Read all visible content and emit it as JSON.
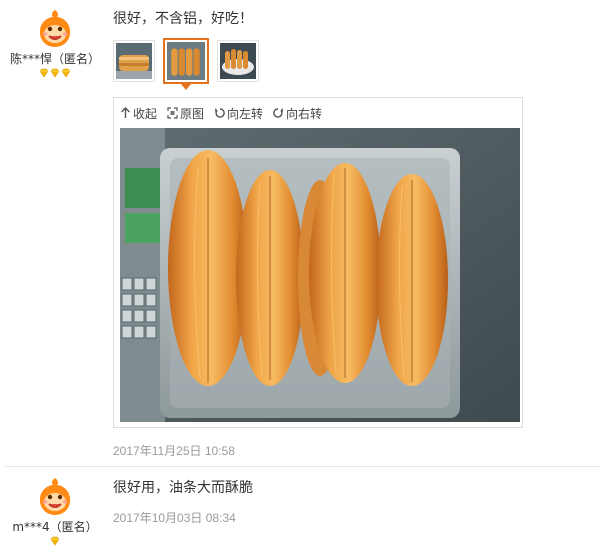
{
  "reviews": [
    {
      "user": {
        "nickname": "陈***悍（匿名）",
        "avatar_icon": "orange-mascot-avatar-icon",
        "badge_icon": "gold-diamond-icon",
        "badge_count": 3
      },
      "text": "很好，不含铝，好吃！",
      "thumbnails": [
        {
          "icon": "photo-thumbnail-icon",
          "active": false
        },
        {
          "icon": "photo-thumbnail-icon",
          "active": true
        },
        {
          "icon": "photo-thumbnail-icon",
          "active": false
        }
      ],
      "viewer": {
        "tools": {
          "collapse": "收起",
          "original": "原图",
          "rotate_left": "向左转",
          "rotate_right": "向右转"
        }
      },
      "date": "2017年11月25日 10:58"
    },
    {
      "user": {
        "nickname": "m***4（匿名）",
        "avatar_icon": "orange-mascot-avatar-icon",
        "badge_icon": "gold-diamond-icon",
        "badge_count": 1
      },
      "text": "很好用，油条大而酥脆",
      "date": "2017年10月03日 08:34"
    }
  ],
  "colors": {
    "accent": "#e4711c",
    "avatar": "#ff8a14",
    "badge": "#f5b800",
    "date_text": "#9a9a9a"
  }
}
